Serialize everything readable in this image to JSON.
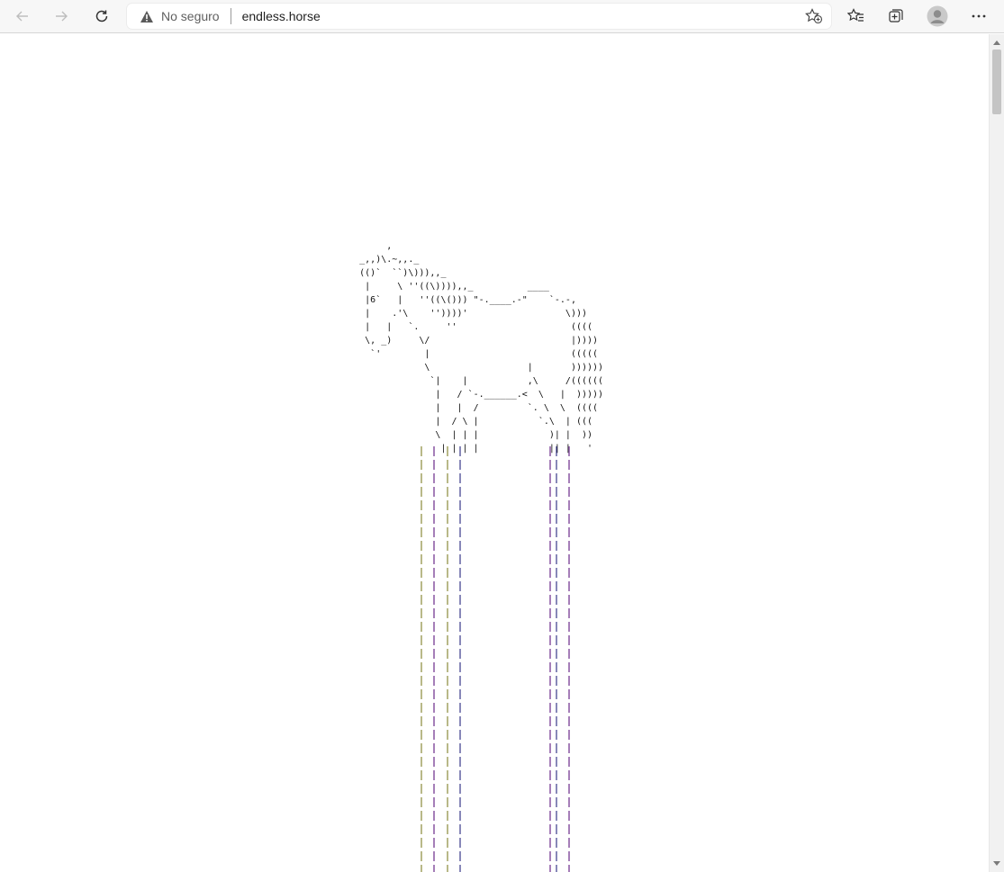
{
  "browser": {
    "security_label": "No seguro",
    "url": "endless.horse",
    "icons": {
      "back": "back-arrow-icon",
      "forward": "forward-arrow-icon",
      "refresh": "refresh-icon",
      "warning": "warning-icon",
      "add_favorite": "star-add-icon",
      "favorites": "favorites-icon",
      "collections": "collections-icon",
      "profile": "avatar",
      "menu": "more-icon"
    }
  },
  "page": {
    "horse_ascii": "            ,\n       _,,)\\.~,,._\n       (()`  ``)\\))),,_\n        |     \\ ''((\\)))),,_          ____\n        |6`   |   ''((\\())) \"-.____.-\"    `-.-,\n        |    .'\\    ''))))'                  \\)))\n        |   |   `.     ''                     ((((\n        \\, _)     \\/                          |))))\n         `'        |                          (((((\n                   \\                  |       ))))))\n                    `|    |           ,\\     /((((((\n                     |   / `-.______.<  \\   |  )))))\n                     |   |  /         `. \\  \\  ((((\n                     |  / \\ |           `.\\  | (((\n                     \\  | | |             )| |  ))\n                      | | | |             || |   '",
    "leg_colors": [
      "#8a8a3a",
      "#6a2a8a",
      "#8a8a3a",
      "#3a3a8a",
      "#6a2a8a",
      "#3a3a8a",
      "#6a2a8a"
    ]
  }
}
